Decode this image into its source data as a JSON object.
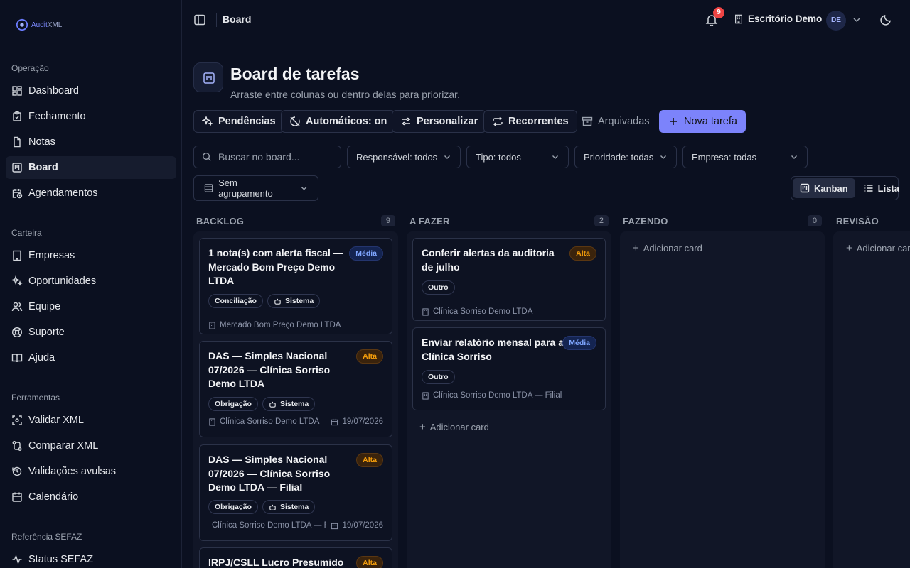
{
  "brand": {
    "name_prefix": "Audit",
    "name_suffix": "XML"
  },
  "sidebar": {
    "sections": [
      {
        "title": "Operação",
        "items": [
          {
            "label": "Dashboard",
            "icon": "dashboard-icon"
          },
          {
            "label": "Fechamento",
            "icon": "clipboard-icon"
          },
          {
            "label": "Notas",
            "icon": "file-icon"
          },
          {
            "label": "Board",
            "icon": "board-icon",
            "active": true
          },
          {
            "label": "Agendamentos",
            "icon": "calendar-clock-icon"
          }
        ]
      },
      {
        "title": "Carteira",
        "items": [
          {
            "label": "Empresas",
            "icon": "building-icon"
          },
          {
            "label": "Oportunidades",
            "icon": "sparkles-icon"
          },
          {
            "label": "Equipe",
            "icon": "users-icon"
          },
          {
            "label": "Suporte",
            "icon": "lifebuoy-icon"
          },
          {
            "label": "Ajuda",
            "icon": "book-icon"
          }
        ]
      },
      {
        "title": "Ferramentas",
        "items": [
          {
            "label": "Validar XML",
            "icon": "scan-icon"
          },
          {
            "label": "Comparar XML",
            "icon": "compare-icon"
          },
          {
            "label": "Validações avulsas",
            "icon": "history-icon"
          },
          {
            "label": "Calendário",
            "icon": "calendar-icon"
          }
        ]
      },
      {
        "title": "Referência SEFAZ",
        "items": [
          {
            "label": "Status SEFAZ",
            "icon": "status-icon"
          }
        ]
      }
    ]
  },
  "topbar": {
    "title": "Board",
    "notifications_count": "9",
    "office": "Escritório Demo",
    "avatar_initials": "DE"
  },
  "header": {
    "title": "Board de tarefas",
    "subtitle": "Arraste entre colunas ou dentro delas para priorizar."
  },
  "toolbar": {
    "pendencias": "Pendências",
    "automaticos": "Automáticos: on",
    "personalizar": "Personalizar",
    "recorrentes": "Recorrentes",
    "arquivadas": "Arquivadas",
    "nova_tarefa": "Nova tarefa"
  },
  "filters": {
    "search_placeholder": "Buscar no board...",
    "responsavel": "Responsável: todos",
    "tipo": "Tipo: todos",
    "prioridade": "Prioridade: todas",
    "empresa": "Empresa: todas",
    "agrupamento": "Sem agrupamento"
  },
  "view": {
    "kanban": "Kanban",
    "lista": "Lista",
    "active": "Kanban"
  },
  "add_card_label": "Adicionar card",
  "columns": [
    {
      "title": "BACKLOG",
      "count": "9",
      "cards": [
        {
          "title": "1 nota(s) com alerta fiscal — Mercado Bom Preço Demo LTDA",
          "priority": "Média",
          "tags": [
            "Conciliação",
            "Sistema"
          ],
          "company": "Mercado Bom Preço Demo LTDA",
          "date": ""
        },
        {
          "title": "DAS — Simples Nacional 07/2026 — Clínica Sorriso Demo LTDA",
          "priority": "Alta",
          "tags": [
            "Obrigação",
            "Sistema"
          ],
          "company": "Clínica Sorriso Demo LTDA",
          "date": "19/07/2026"
        },
        {
          "title": "DAS — Simples Nacional 07/2026 — Clínica Sorriso Demo LTDA — Filial",
          "priority": "Alta",
          "tags": [
            "Obrigação",
            "Sistema"
          ],
          "company": "Clínica Sorriso Demo LTDA — Filial",
          "date": "19/07/2026"
        },
        {
          "title": "IRPJ/CSLL Lucro Presumido —",
          "priority": "Alta",
          "tags": [],
          "company": "",
          "date": ""
        }
      ]
    },
    {
      "title": "A FAZER",
      "count": "2",
      "cards": [
        {
          "title": "Conferir alertas da auditoria de julho",
          "priority": "Alta",
          "tags": [
            "Outro"
          ],
          "company": "Clínica Sorriso Demo LTDA",
          "date": ""
        },
        {
          "title": "Enviar relatório mensal para a Clínica Sorriso",
          "priority": "Média",
          "tags": [
            "Outro"
          ],
          "company": "Clínica Sorriso Demo LTDA — Filial",
          "date": ""
        }
      ]
    },
    {
      "title": "FAZENDO",
      "count": "0",
      "cards": []
    },
    {
      "title": "REVISÃO",
      "count": "",
      "cards": []
    }
  ],
  "colors": {
    "accent": "#7c83fb",
    "alta": "#f59e0b",
    "media": "#7fa6ff",
    "badge": "#ef4444"
  }
}
